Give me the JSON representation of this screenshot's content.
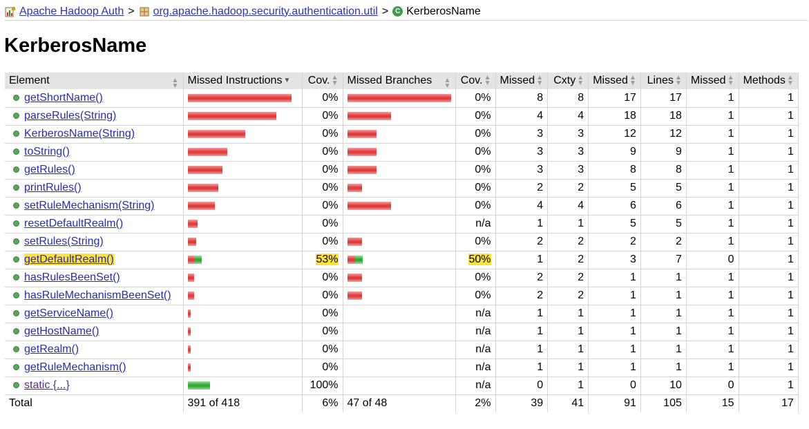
{
  "breadcrumb": {
    "root": "Apache Hadoop Auth",
    "package": "org.apache.hadoop.security.authentication.util",
    "current": "KerberosName",
    "separator": ">",
    "root_icon": "report-icon",
    "package_icon": "package-icon",
    "class_icon": "class-icon",
    "class_icon_glyph": "C"
  },
  "page_title": "KerberosName",
  "colors": {
    "missed_bar": "#e03a3a",
    "covered_bar": "#2fa82f",
    "highlight": "#fbe33b",
    "header_bg": "#e4e4e4"
  },
  "table": {
    "headers": {
      "element": "Element",
      "missed_instructions": "Missed Instructions",
      "cov1": "Cov.",
      "missed_branches": "Missed Branches",
      "cov2": "Cov.",
      "missed_cxty": "Missed",
      "cxty": "Cxty",
      "missed_lines": "Missed",
      "lines": "Lines",
      "missed_methods": "Missed",
      "methods": "Methods"
    },
    "rows": [
      {
        "name": "getShortName()",
        "ins_missed_frac": 1.0,
        "ins_covered_frac": 0,
        "cov1": "0%",
        "br_missed_frac": 1.0,
        "br_covered_frac": 0,
        "cov2": "0%",
        "missed_cxty": "8",
        "cxty": "8",
        "missed_lines": "17",
        "lines": "17",
        "missed_methods": "1",
        "methods": "1"
      },
      {
        "name": "parseRules(String)",
        "ins_missed_frac": 0.85,
        "ins_covered_frac": 0,
        "cov1": "0%",
        "br_missed_frac": 0.42,
        "br_covered_frac": 0,
        "cov2": "0%",
        "missed_cxty": "4",
        "cxty": "4",
        "missed_lines": "18",
        "lines": "18",
        "missed_methods": "1",
        "methods": "1"
      },
      {
        "name": "KerberosName(String)",
        "ins_missed_frac": 0.55,
        "ins_covered_frac": 0,
        "cov1": "0%",
        "br_missed_frac": 0.28,
        "br_covered_frac": 0,
        "cov2": "0%",
        "missed_cxty": "3",
        "cxty": "3",
        "missed_lines": "12",
        "lines": "12",
        "missed_methods": "1",
        "methods": "1"
      },
      {
        "name": "toString()",
        "ins_missed_frac": 0.38,
        "ins_covered_frac": 0,
        "cov1": "0%",
        "br_missed_frac": 0.28,
        "br_covered_frac": 0,
        "cov2": "0%",
        "missed_cxty": "3",
        "cxty": "3",
        "missed_lines": "9",
        "lines": "9",
        "missed_methods": "1",
        "methods": "1"
      },
      {
        "name": "getRules()",
        "ins_missed_frac": 0.33,
        "ins_covered_frac": 0,
        "cov1": "0%",
        "br_missed_frac": 0.28,
        "br_covered_frac": 0,
        "cov2": "0%",
        "missed_cxty": "3",
        "cxty": "3",
        "missed_lines": "8",
        "lines": "8",
        "missed_methods": "1",
        "methods": "1"
      },
      {
        "name": "printRules()",
        "ins_missed_frac": 0.29,
        "ins_covered_frac": 0,
        "cov1": "0%",
        "br_missed_frac": 0.14,
        "br_covered_frac": 0,
        "cov2": "0%",
        "missed_cxty": "2",
        "cxty": "2",
        "missed_lines": "5",
        "lines": "5",
        "missed_methods": "1",
        "methods": "1"
      },
      {
        "name": "setRuleMechanism(String)",
        "ins_missed_frac": 0.26,
        "ins_covered_frac": 0,
        "cov1": "0%",
        "br_missed_frac": 0.42,
        "br_covered_frac": 0,
        "cov2": "0%",
        "missed_cxty": "4",
        "cxty": "4",
        "missed_lines": "6",
        "lines": "6",
        "missed_methods": "1",
        "methods": "1"
      },
      {
        "name": "resetDefaultRealm()",
        "ins_missed_frac": 0.09,
        "ins_covered_frac": 0,
        "cov1": "0%",
        "br_missed_frac": 0,
        "br_covered_frac": 0,
        "cov2": "n/a",
        "missed_cxty": "1",
        "cxty": "1",
        "missed_lines": "5",
        "lines": "5",
        "missed_methods": "1",
        "methods": "1"
      },
      {
        "name": "setRules(String)",
        "ins_missed_frac": 0.08,
        "ins_covered_frac": 0,
        "cov1": "0%",
        "br_missed_frac": 0.14,
        "br_covered_frac": 0,
        "cov2": "0%",
        "missed_cxty": "2",
        "cxty": "2",
        "missed_lines": "2",
        "lines": "2",
        "missed_methods": "1",
        "methods": "1"
      },
      {
        "name": "getDefaultRealm()",
        "ins_missed_frac": 0.06,
        "ins_covered_frac": 0.07,
        "cov1": "53%",
        "br_missed_frac": 0.07,
        "br_covered_frac": 0.07,
        "cov2": "50%",
        "missed_cxty": "1",
        "cxty": "2",
        "missed_lines": "3",
        "lines": "7",
        "missed_methods": "0",
        "methods": "1",
        "highlight": true
      },
      {
        "name": "hasRulesBeenSet()",
        "ins_missed_frac": 0.06,
        "ins_covered_frac": 0,
        "cov1": "0%",
        "br_missed_frac": 0.14,
        "br_covered_frac": 0,
        "cov2": "0%",
        "missed_cxty": "2",
        "cxty": "2",
        "missed_lines": "1",
        "lines": "1",
        "missed_methods": "1",
        "methods": "1"
      },
      {
        "name": "hasRuleMechanismBeenSet()",
        "ins_missed_frac": 0.06,
        "ins_covered_frac": 0,
        "cov1": "0%",
        "br_missed_frac": 0.14,
        "br_covered_frac": 0,
        "cov2": "0%",
        "missed_cxty": "2",
        "cxty": "2",
        "missed_lines": "1",
        "lines": "1",
        "missed_methods": "1",
        "methods": "1"
      },
      {
        "name": "getServiceName()",
        "ins_missed_frac": 0.025,
        "ins_covered_frac": 0,
        "cov1": "0%",
        "br_missed_frac": 0,
        "br_covered_frac": 0,
        "cov2": "n/a",
        "missed_cxty": "1",
        "cxty": "1",
        "missed_lines": "1",
        "lines": "1",
        "missed_methods": "1",
        "methods": "1"
      },
      {
        "name": "getHostName()",
        "ins_missed_frac": 0.025,
        "ins_covered_frac": 0,
        "cov1": "0%",
        "br_missed_frac": 0,
        "br_covered_frac": 0,
        "cov2": "n/a",
        "missed_cxty": "1",
        "cxty": "1",
        "missed_lines": "1",
        "lines": "1",
        "missed_methods": "1",
        "methods": "1"
      },
      {
        "name": "getRealm()",
        "ins_missed_frac": 0.025,
        "ins_covered_frac": 0,
        "cov1": "0%",
        "br_missed_frac": 0,
        "br_covered_frac": 0,
        "cov2": "n/a",
        "missed_cxty": "1",
        "cxty": "1",
        "missed_lines": "1",
        "lines": "1",
        "missed_methods": "1",
        "methods": "1"
      },
      {
        "name": "getRuleMechanism()",
        "ins_missed_frac": 0.02,
        "ins_covered_frac": 0,
        "cov1": "0%",
        "br_missed_frac": 0,
        "br_covered_frac": 0,
        "cov2": "n/a",
        "missed_cxty": "1",
        "cxty": "1",
        "missed_lines": "1",
        "lines": "1",
        "missed_methods": "1",
        "methods": "1"
      },
      {
        "name": "static {...}",
        "ins_missed_frac": 0,
        "ins_covered_frac": 0.21,
        "cov1": "100%",
        "br_missed_frac": 0,
        "br_covered_frac": 0,
        "cov2": "n/a",
        "missed_cxty": "0",
        "cxty": "1",
        "missed_lines": "0",
        "lines": "10",
        "missed_methods": "0",
        "methods": "1",
        "visited": true
      }
    ],
    "total": {
      "label": "Total",
      "instructions": "391 of 418",
      "cov1": "6%",
      "branches": "47 of 48",
      "cov2": "2%",
      "missed_cxty": "39",
      "cxty": "41",
      "missed_lines": "91",
      "lines": "105",
      "missed_methods": "15",
      "methods": "17"
    }
  }
}
